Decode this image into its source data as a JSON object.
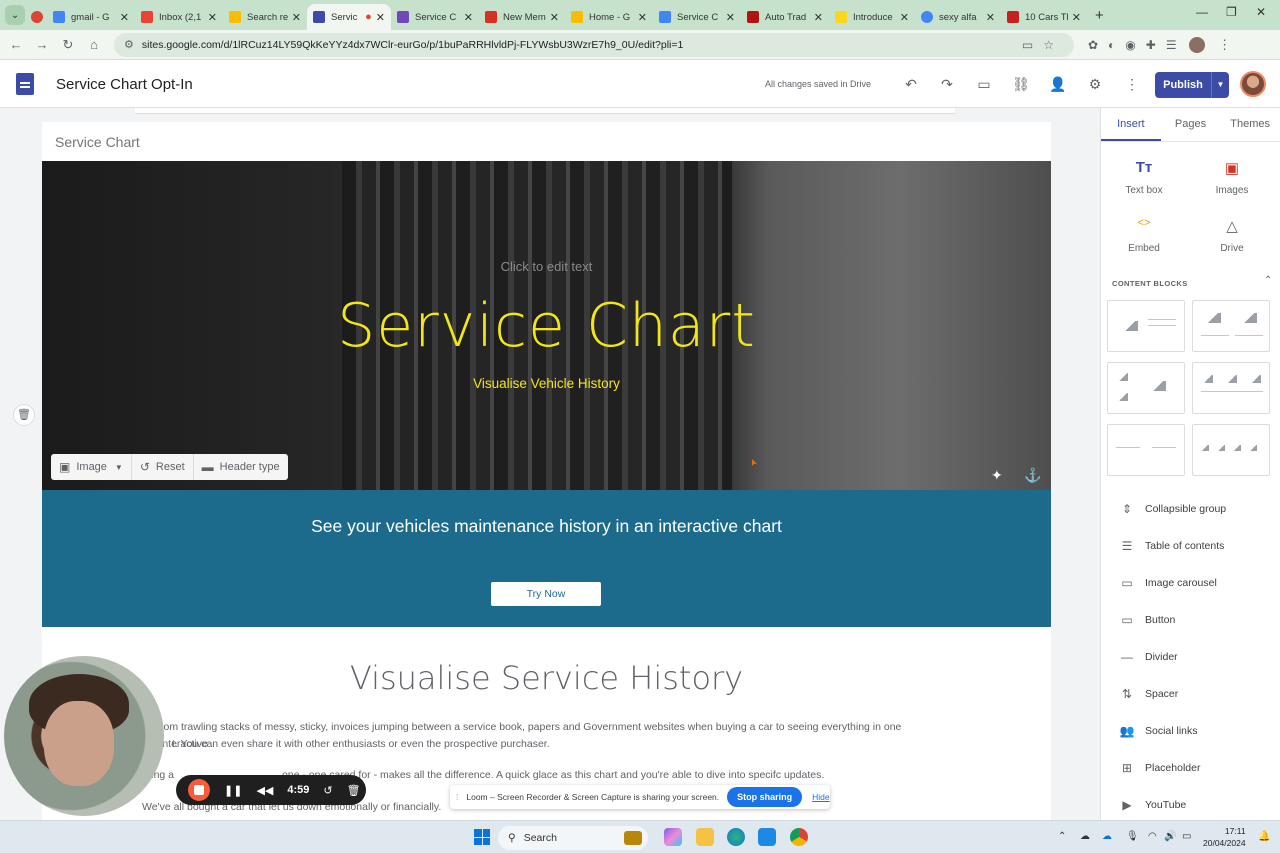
{
  "browser": {
    "tabs": [
      {
        "label": "",
        "color": "#db4437"
      },
      {
        "label": "gmail - G",
        "color": "#4285f4"
      },
      {
        "label": "Inbox (2,1",
        "color": "#ea4335"
      },
      {
        "label": "Search re",
        "color": "#fbbc04"
      },
      {
        "label": "Servic",
        "color": "#3c4ba6",
        "active": true
      },
      {
        "label": "Service C",
        "color": "#7248b9"
      },
      {
        "label": "New Mem",
        "color": "#d93025"
      },
      {
        "label": "Home - G",
        "color": "#fbbc04"
      },
      {
        "label": "Service C",
        "color": "#4285f4"
      },
      {
        "label": "Auto Trad",
        "color": "#b31412"
      },
      {
        "label": "Introduce",
        "color": "#f9d71c"
      },
      {
        "label": "sexy alfa",
        "color": "#4285f4"
      },
      {
        "label": "10 Cars Th",
        "color": "#c5221f"
      }
    ],
    "url": "sites.google.com/d/1lRCuz14LY59QkKeYYz4dx7WClr-eurGo/p/1buPaRRHlvldPj-FLYWsbU3WzrE7h9_0U/edit?pli=1"
  },
  "sites": {
    "doc_title": "Service Chart Opt-In",
    "saved_status": "All changes saved in Drive",
    "publish_label": "Publish"
  },
  "page": {
    "site_title": "Service Chart",
    "hero": {
      "placeholder": "Click to edit text",
      "title": "Service Chart",
      "subtitle": "Visualise Vehicle History",
      "tools": {
        "image": "Image",
        "reset": "Reset",
        "header_type": "Header type"
      }
    },
    "band": {
      "headline": "See your vehicles maintenance history in an interactive chart",
      "button": "Try Now"
    },
    "section": {
      "title": "Visualise Service History",
      "p1a": "rom trawling stacks of messy, sticky, invoices jumping between a service book, papers and Government websites when buying a car to seeing everything in one interactive",
      "p1b": "t. You can even share it with other enthusiasts or even the prospective purchaser.",
      "p2": "ying a                                     one - one cared for - makes all the difference. A quick glace as this chart and you're able to dive into specifc updates.",
      "p3": "We've all bought a car that let us down emotionally or financially."
    }
  },
  "panel": {
    "tabs": [
      "Insert",
      "Pages",
      "Themes"
    ],
    "insert": [
      {
        "label": "Text box",
        "icon": "Tт"
      },
      {
        "label": "Images",
        "icon": "▣"
      },
      {
        "label": "Embed",
        "icon": "<>"
      },
      {
        "label": "Drive",
        "icon": "△"
      }
    ],
    "content_blocks_label": "CONTENT BLOCKS",
    "items": [
      {
        "label": "Collapsible group",
        "icon": "⇕"
      },
      {
        "label": "Table of contents",
        "icon": "☰"
      },
      {
        "label": "Image carousel",
        "icon": "▭"
      },
      {
        "label": "Button",
        "icon": "▭"
      },
      {
        "label": "Divider",
        "icon": "—"
      },
      {
        "label": "Spacer",
        "icon": "⇅"
      },
      {
        "label": "Social links",
        "icon": "👥"
      },
      {
        "label": "Placeholder",
        "icon": "⊞"
      },
      {
        "label": "YouTube",
        "icon": "▶"
      }
    ]
  },
  "loom": {
    "timer": "4:59",
    "share_text": "Loom – Screen Recorder & Screen Capture is sharing your screen.",
    "stop_label": "Stop sharing",
    "hide_label": "Hide"
  },
  "taskbar": {
    "search": "Search",
    "time": "17:11",
    "date": "20/04/2024"
  }
}
